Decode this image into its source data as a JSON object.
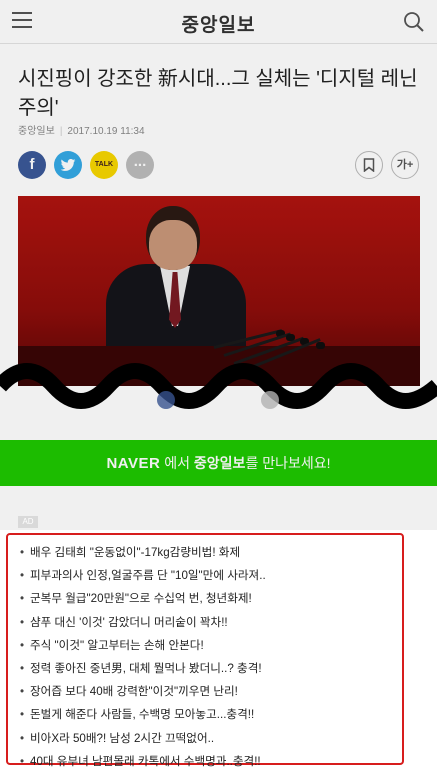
{
  "header": {
    "logo": "중앙일보",
    "menu_icon": "hamburger-menu-icon",
    "search_icon": "search-icon"
  },
  "article": {
    "title": "시진핑이 강조한 新시대...그 실체는 '디지털 레닌주의'",
    "source": "중앙일보",
    "date": "2017.10.19 11:34"
  },
  "share": {
    "facebook": "f",
    "twitter_icon": "twitter-icon",
    "kakaotalk": "TALK",
    "more": "...",
    "bookmark_icon": "bookmark-icon",
    "font_size": "가+"
  },
  "banner": {
    "naver": "NAVER",
    "middle": " 에서 ",
    "brand": "중앙일보",
    "rest": "를 만나보세요!",
    "color": "#1ec800"
  },
  "ad": {
    "badge": "AD",
    "border_color": "#d71d1d",
    "items": [
      "배우 김태희 \"운동없이\"-17kg감량비법! 화제",
      "피부과의사 인정,얼굴주름 단 \"10일\"만에 사라져..",
      "군복무 월급\"20만원\"으로 수십억 번, 청년화제!",
      "샴푸 대신 '이것' 감았더니 머리숱이 꽉차!!",
      "주식 \"이것\" 알고부터는 손해 안본다!",
      "정력 좋아진 중년男, 대체 뭘먹나 봤더니..? 충격!",
      "장어즙 보다 40배 강력한\"이것\"끼우면 난리!",
      "돈벌게 해준다 사람들, 수백명 모아놓고...충격!!",
      "비아X라 50배?! 남성 2시간 끄떡없어..",
      "40대 유부녀 남편몰래 카톡에서 수백명과..충격!!"
    ]
  }
}
